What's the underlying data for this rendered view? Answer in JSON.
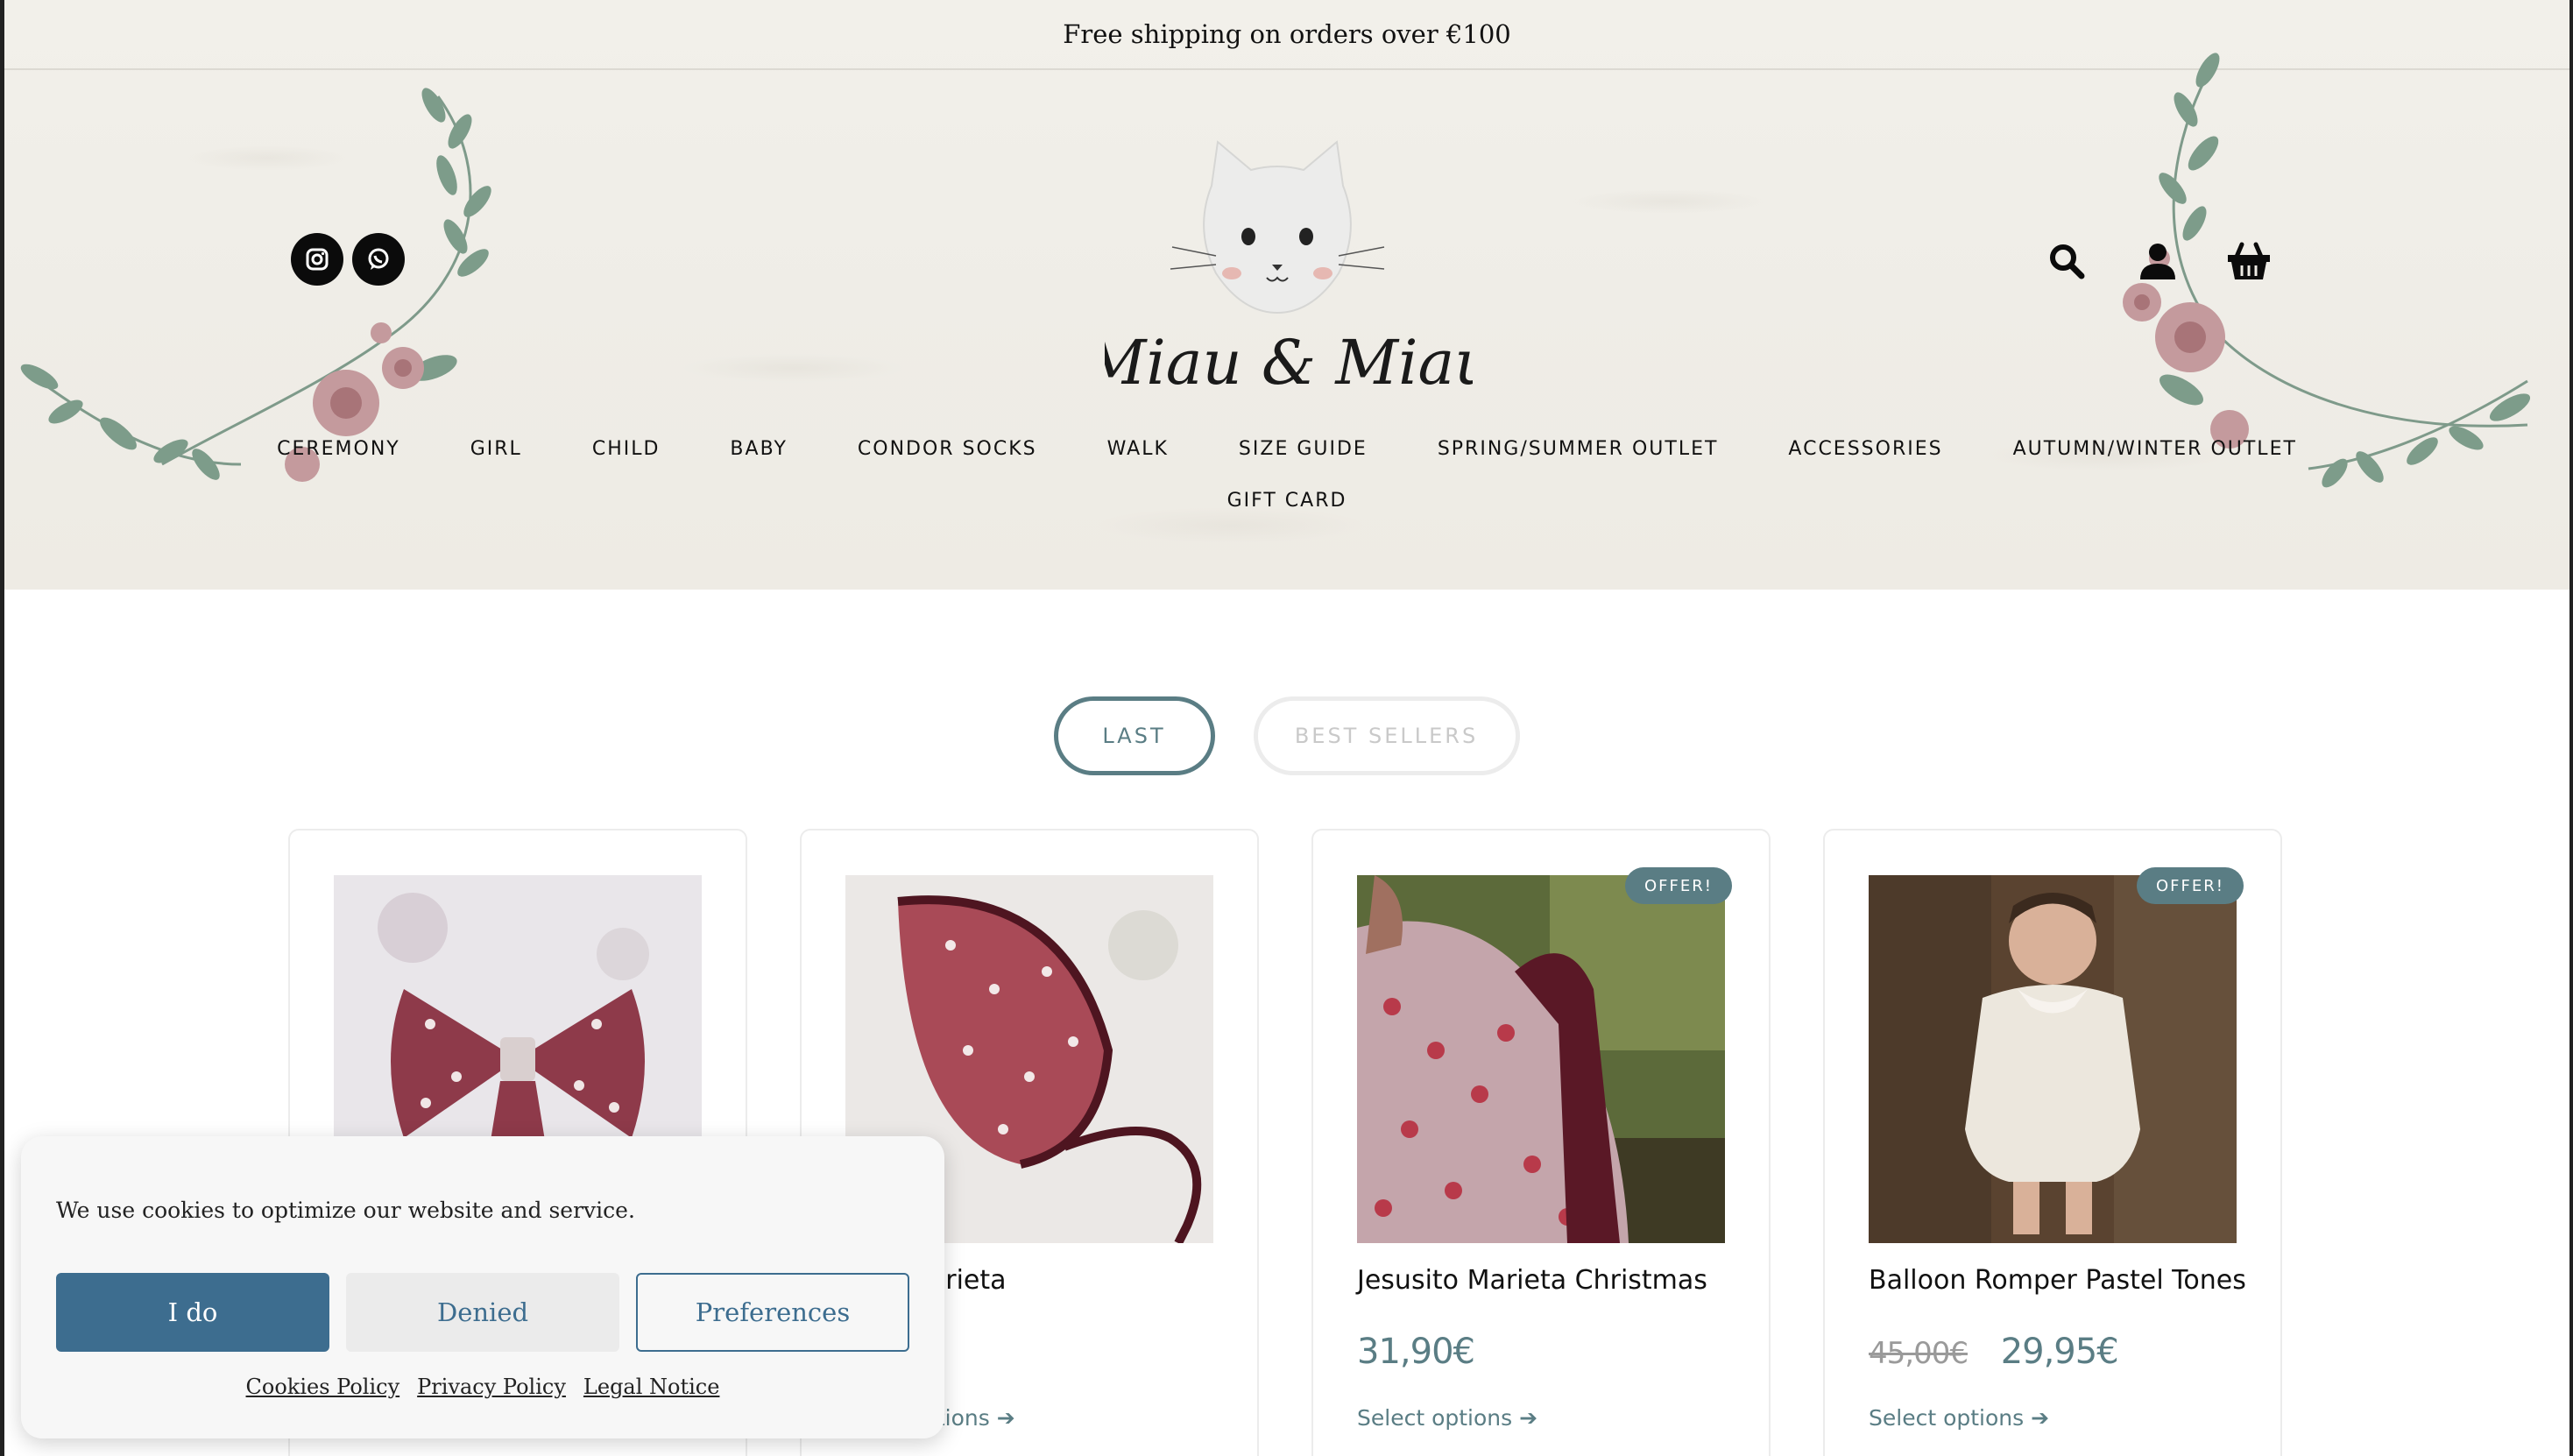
{
  "topbar": {
    "text": "Free shipping on orders over €100"
  },
  "header": {
    "brand": "Miau & Miau",
    "social": [
      {
        "icon": "instagram-icon"
      },
      {
        "icon": "whatsapp-icon"
      }
    ],
    "actions": [
      {
        "icon": "search-icon"
      },
      {
        "icon": "account-icon"
      },
      {
        "icon": "basket-icon"
      }
    ]
  },
  "nav": {
    "row1": [
      "CEREMONY",
      "GIRL",
      "CHILD",
      "BABY",
      "CONDOR SOCKS",
      "WALK",
      "SIZE GUIDE",
      "SPRING/SUMMER OUTLET",
      "ACCESSORIES",
      "AUTUMN/WINTER OUTLET"
    ],
    "row2": [
      "GIFT CARD"
    ]
  },
  "tabs": {
    "last": "LAST",
    "best": "BEST SELLERS"
  },
  "products": [
    {
      "title": "",
      "price": "",
      "old_price": "",
      "select": "",
      "badge": ""
    },
    {
      "title": "Marieta",
      "price": "€",
      "old_price": "",
      "select": "ptions",
      "badge": ""
    },
    {
      "title": "Jesusito Marieta Christmas",
      "price": "31,90€",
      "old_price": "",
      "select": "Select options",
      "badge": "OFFER!"
    },
    {
      "title": "Balloon Romper Pastel Tones",
      "price": "29,95€",
      "old_price": "45,00€",
      "select": "Select options",
      "badge": "OFFER!"
    }
  ],
  "cookie": {
    "message": "We use cookies to optimize our website and service.",
    "accept": "I do",
    "deny": "Denied",
    "preferences": "Preferences",
    "links": [
      "Cookies Policy",
      "Privacy Policy",
      "Legal Notice"
    ]
  },
  "colors": {
    "accent": "#5a7d84",
    "cookie_blue": "#3d6d8f"
  }
}
